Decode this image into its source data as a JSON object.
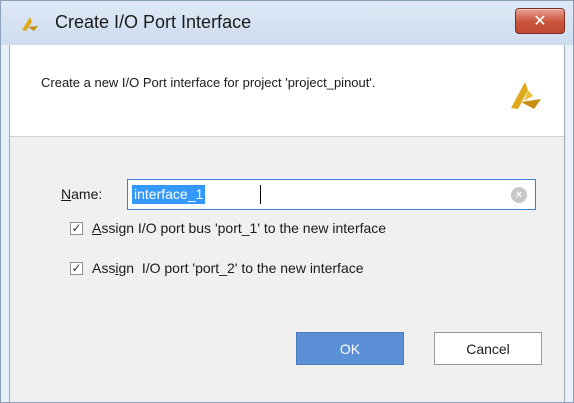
{
  "window": {
    "title": "Create I/O Port Interface",
    "close_glyph": "✕",
    "logo_icon": "vivado-logo-icon"
  },
  "header": {
    "description": "Create a new I/O Port interface for project 'project_pinout'.",
    "logo_icon": "vivado-logo-icon"
  },
  "form": {
    "name_label": "Name:",
    "name_value": "interface_1",
    "clear_icon": "clear-icon"
  },
  "options": [
    {
      "label": "Assign I/O port bus 'port_1' to the new interface",
      "checked": true
    },
    {
      "label": "Assign  I/O port 'port_2' to the new interface",
      "checked": true
    }
  ],
  "buttons": {
    "ok": "OK",
    "cancel": "Cancel"
  },
  "colors": {
    "accent": "#5b8fd6",
    "close": "#c8523a",
    "logo": "#e0a91b"
  }
}
